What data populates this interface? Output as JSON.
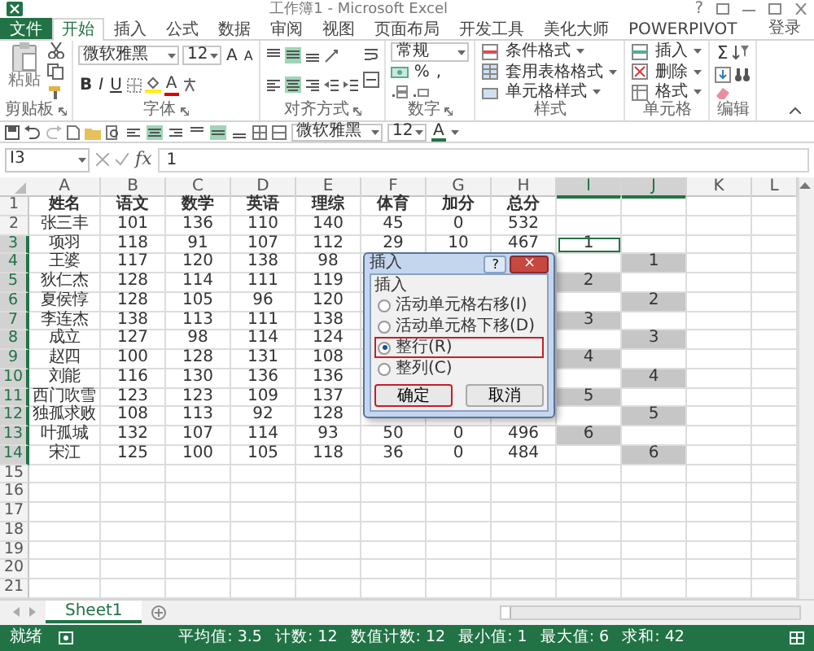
{
  "window": {
    "title": "工作簿1 - Microsoft Excel",
    "help": "?"
  },
  "ribbon_tabs": [
    {
      "label": "文件",
      "kind": "file",
      "selected": false
    },
    {
      "label": "开始",
      "kind": "tab",
      "selected": true
    },
    {
      "label": "插入",
      "kind": "tab",
      "selected": false
    },
    {
      "label": "公式",
      "kind": "tab",
      "selected": false
    },
    {
      "label": "数据",
      "kind": "tab",
      "selected": false
    },
    {
      "label": "审阅",
      "kind": "tab",
      "selected": false
    },
    {
      "label": "视图",
      "kind": "tab",
      "selected": false
    },
    {
      "label": "页面布局",
      "kind": "tab",
      "selected": false
    },
    {
      "label": "开发工具",
      "kind": "tab",
      "selected": false
    },
    {
      "label": "美化大师",
      "kind": "tab",
      "selected": false
    },
    {
      "label": "POWERPIVOT",
      "kind": "tab",
      "selected": false
    }
  ],
  "account": "登录",
  "ribbon": {
    "clipboard": {
      "paste": "粘贴",
      "label": "剪贴板"
    },
    "font": {
      "name": "微软雅黑",
      "size": "12",
      "grow": "A",
      "shrink": "A",
      "styles": [
        "B",
        "I",
        "U"
      ],
      "color_letter": "A",
      "label": "字体"
    },
    "alignment": {
      "vertical": [
        {
          "selected": false
        },
        {
          "selected": true
        },
        {
          "selected": false
        }
      ],
      "horizontal": [
        {
          "selected": false
        },
        {
          "selected": true
        },
        {
          "selected": false
        }
      ],
      "label": "对齐方式"
    },
    "number": {
      "format": "常规",
      "percent": "%",
      "comma": ",",
      "label": "数字"
    },
    "styles": {
      "items": [
        "条件格式",
        "套用表格格式",
        "单元格样式"
      ],
      "label": "样式"
    },
    "cells": {
      "items": [
        "插入",
        "删除",
        "格式"
      ],
      "label": "单元格"
    },
    "editing": {
      "sum": "Σ",
      "label": "编辑"
    }
  },
  "quick_access": {
    "align_buttons": [
      {
        "selected": false
      },
      {
        "selected": true
      },
      {
        "selected": false
      },
      {
        "selected": false
      },
      {
        "selected": true
      },
      {
        "selected": false
      }
    ],
    "font": "微软雅黑",
    "size": "12",
    "color_letter": "A"
  },
  "formula_bar": {
    "name_box": "I3",
    "function_label": "fx",
    "value": "1"
  },
  "columns": [
    {
      "label": "A",
      "selected": false
    },
    {
      "label": "B",
      "selected": false
    },
    {
      "label": "C",
      "selected": false
    },
    {
      "label": "D",
      "selected": false
    },
    {
      "label": "E",
      "selected": false
    },
    {
      "label": "F",
      "selected": false
    },
    {
      "label": "G",
      "selected": false
    },
    {
      "label": "H",
      "selected": false
    },
    {
      "label": "I",
      "selected": true
    },
    {
      "label": "J",
      "selected": true
    },
    {
      "label": "K",
      "selected": false
    },
    {
      "label": "L",
      "selected": false
    }
  ],
  "rows": [
    {
      "header": "1",
      "selected": false,
      "kind": "header",
      "cells": [
        "姓名",
        "语文",
        "数学",
        "英语",
        "理综",
        "体育",
        "加分",
        "总分",
        null,
        null,
        null
      ]
    },
    {
      "header": "2",
      "selected": false,
      "kind": "data",
      "cells": [
        "张三丰",
        "101",
        "136",
        "110",
        "140",
        "45",
        "0",
        "532",
        null,
        null,
        null
      ]
    },
    {
      "header": "3",
      "selected": true,
      "kind": "data",
      "cells": [
        "项羽",
        "118",
        "91",
        "107",
        "112",
        "29",
        "10",
        "467",
        {
          "text": "1",
          "selected": false,
          "active": true
        },
        null,
        null
      ]
    },
    {
      "header": "4",
      "selected": true,
      "kind": "data",
      "cells": [
        "王婆",
        "117",
        "120",
        "138",
        "98",
        null,
        null,
        null,
        null,
        {
          "text": "1",
          "selected": true,
          "active": false
        },
        null
      ]
    },
    {
      "header": "5",
      "selected": true,
      "kind": "data",
      "cells": [
        "狄仁杰",
        "128",
        "114",
        "111",
        "119",
        null,
        null,
        null,
        {
          "text": "2",
          "selected": true,
          "active": false
        },
        null,
        null
      ]
    },
    {
      "header": "6",
      "selected": true,
      "kind": "data",
      "cells": [
        "夏侯惇",
        "128",
        "105",
        "96",
        "120",
        null,
        null,
        null,
        null,
        {
          "text": "2",
          "selected": true,
          "active": false
        },
        null
      ]
    },
    {
      "header": "7",
      "selected": true,
      "kind": "data",
      "cells": [
        "李连杰",
        "138",
        "113",
        "111",
        "138",
        null,
        null,
        null,
        {
          "text": "3",
          "selected": true,
          "active": false
        },
        null,
        null
      ]
    },
    {
      "header": "8",
      "selected": true,
      "kind": "data",
      "cells": [
        "成立",
        "127",
        "98",
        "114",
        "124",
        null,
        null,
        null,
        null,
        {
          "text": "3",
          "selected": true,
          "active": false
        },
        null
      ]
    },
    {
      "header": "9",
      "selected": true,
      "kind": "data",
      "cells": [
        "赵四",
        "100",
        "128",
        "131",
        "108",
        null,
        null,
        null,
        {
          "text": "4",
          "selected": true,
          "active": false
        },
        null,
        null
      ]
    },
    {
      "header": "10",
      "selected": true,
      "kind": "data",
      "cells": [
        "刘能",
        "116",
        "130",
        "136",
        "136",
        null,
        null,
        null,
        null,
        {
          "text": "4",
          "selected": true,
          "active": false
        },
        null
      ]
    },
    {
      "header": "11",
      "selected": true,
      "kind": "data",
      "cells": [
        "西门吹雪",
        "123",
        "123",
        "109",
        "137",
        null,
        null,
        null,
        {
          "text": "5",
          "selected": true,
          "active": false
        },
        null,
        null
      ]
    },
    {
      "header": "12",
      "selected": true,
      "kind": "data",
      "cells": [
        "独孤求败",
        "108",
        "113",
        "92",
        "128",
        null,
        null,
        null,
        null,
        {
          "text": "5",
          "selected": true,
          "active": false
        },
        null
      ]
    },
    {
      "header": "13",
      "selected": true,
      "kind": "data",
      "cells": [
        "叶孤城",
        "132",
        "107",
        "114",
        "93",
        "50",
        "0",
        "496",
        {
          "text": "6",
          "selected": true,
          "active": false
        },
        null,
        null
      ]
    },
    {
      "header": "14",
      "selected": true,
      "kind": "data",
      "cells": [
        "宋江",
        "125",
        "100",
        "105",
        "118",
        "36",
        "0",
        "484",
        null,
        {
          "text": "6",
          "selected": true,
          "active": false
        },
        null
      ]
    },
    {
      "header": "15",
      "selected": false,
      "kind": "data",
      "cells": []
    },
    {
      "header": "16",
      "selected": false,
      "kind": "data",
      "cells": []
    },
    {
      "header": "17",
      "selected": false,
      "kind": "data",
      "cells": []
    },
    {
      "header": "18",
      "selected": false,
      "kind": "data",
      "cells": []
    },
    {
      "header": "19",
      "selected": false,
      "kind": "data",
      "cells": []
    },
    {
      "header": "20",
      "selected": false,
      "kind": "data",
      "cells": []
    },
    {
      "header": "21",
      "selected": false,
      "kind": "data",
      "cells": []
    }
  ],
  "dialog": {
    "title": "插入",
    "help": "?",
    "close": "×",
    "group_label": "插入",
    "options": [
      {
        "label": "活动单元格右移(I)",
        "selected": false,
        "highlighted": false
      },
      {
        "label": "活动单元格下移(D)",
        "selected": false,
        "highlighted": false
      },
      {
        "label": "整行(R)",
        "selected": true,
        "highlighted": true
      },
      {
        "label": "整列(C)",
        "selected": false,
        "highlighted": false
      }
    ],
    "buttons": [
      {
        "label": "确定",
        "highlighted": true
      },
      {
        "label": "取消",
        "highlighted": false
      }
    ]
  },
  "sheet_tabs": [
    {
      "label": "Sheet1",
      "selected": true
    }
  ],
  "status_bar": {
    "state": "就绪",
    "stats": [
      "平均值: 3.5",
      "计数: 12",
      "数值计数: 12",
      "最小值: 1",
      "最大值: 6",
      "求和: 42"
    ]
  }
}
